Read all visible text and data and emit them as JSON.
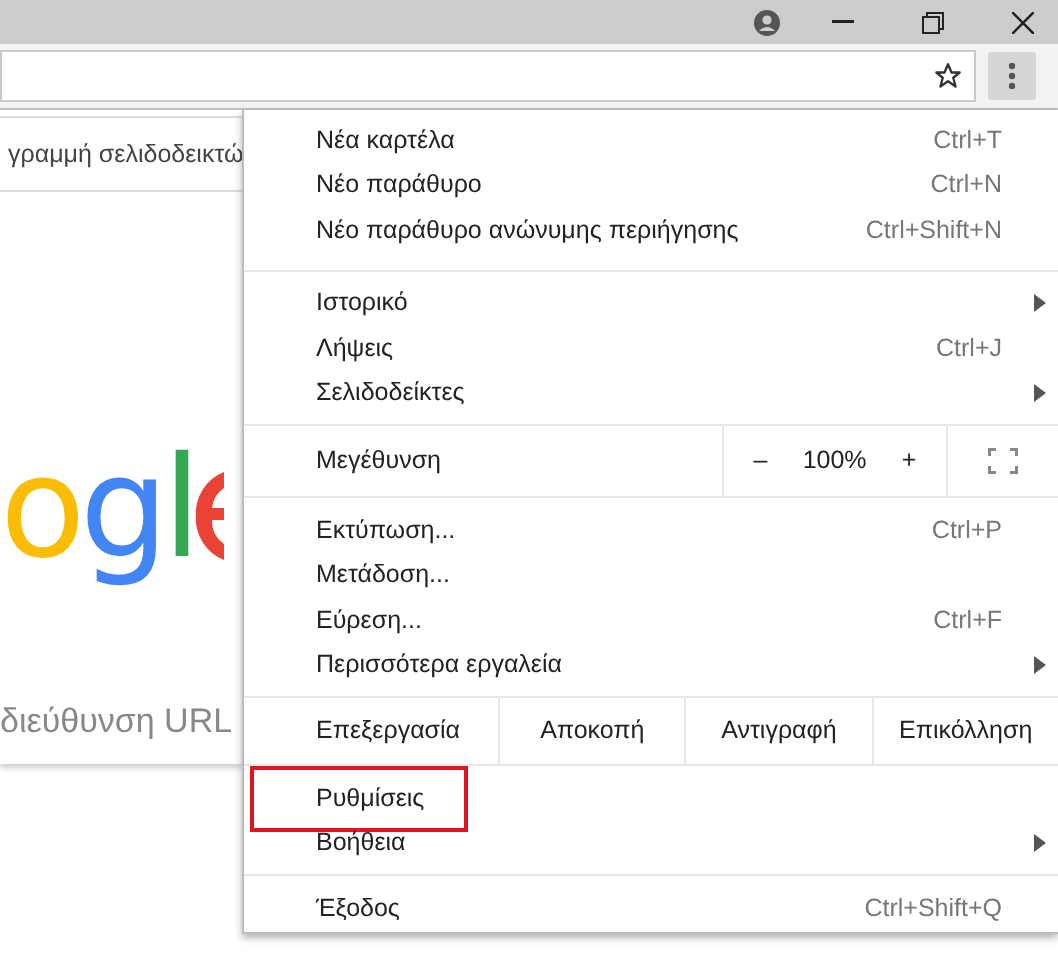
{
  "bookmark_bar": {
    "text": "γραμμή σελιδοδεικτώ"
  },
  "logo": {
    "text": "ogl"
  },
  "search": {
    "placeholder": "διεύθυνση URL"
  },
  "menu": {
    "sections": [
      {
        "items": [
          {
            "kind": "item",
            "label": "Νέα καρτέλα",
            "shortcut": "Ctrl+T",
            "submenu": false,
            "highlighted": false
          },
          {
            "kind": "item",
            "label": "Νέο παράθυρο",
            "shortcut": "Ctrl+N",
            "submenu": false,
            "highlighted": false
          },
          {
            "kind": "item",
            "label": "Νέο παράθυρο ανώνυμης περιήγησης",
            "shortcut": "Ctrl+Shift+N",
            "submenu": false,
            "highlighted": false
          }
        ]
      },
      {
        "items": [
          {
            "kind": "item",
            "label": "Ιστορικό",
            "submenu": true,
            "highlighted": false
          },
          {
            "kind": "item",
            "label": "Λήψεις",
            "shortcut": "Ctrl+J",
            "submenu": false,
            "highlighted": false
          },
          {
            "kind": "item",
            "label": "Σελιδοδείκτες",
            "submenu": true,
            "highlighted": false
          }
        ]
      },
      {
        "items": [
          {
            "kind": "zoom",
            "label": "Μεγέθυνση",
            "minus": "–",
            "value": "100%",
            "plus": "+"
          }
        ]
      },
      {
        "items": [
          {
            "kind": "item",
            "label": "Εκτύπωση...",
            "shortcut": "Ctrl+P",
            "submenu": false,
            "highlighted": false
          },
          {
            "kind": "item",
            "label": "Μετάδοση...",
            "submenu": false,
            "highlighted": false
          },
          {
            "kind": "item",
            "label": "Εύρεση...",
            "shortcut": "Ctrl+F",
            "submenu": false,
            "highlighted": false
          },
          {
            "kind": "item",
            "label": "Περισσότερα εργαλεία",
            "submenu": true,
            "highlighted": false
          }
        ]
      },
      {
        "items": [
          {
            "kind": "edit",
            "label": "Επεξεργασία",
            "actions": [
              "Αποκοπή",
              "Αντιγραφή",
              "Επικόλληση"
            ]
          }
        ]
      },
      {
        "items": [
          {
            "kind": "item",
            "label": "Ρυθμίσεις",
            "submenu": false,
            "highlighted": true
          },
          {
            "kind": "item",
            "label": "Βοήθεια",
            "submenu": true,
            "highlighted": false
          }
        ]
      },
      {
        "items": [
          {
            "kind": "item",
            "label": "Έξοδος",
            "shortcut": "Ctrl+Shift+Q",
            "submenu": false,
            "highlighted": false
          }
        ]
      }
    ]
  }
}
